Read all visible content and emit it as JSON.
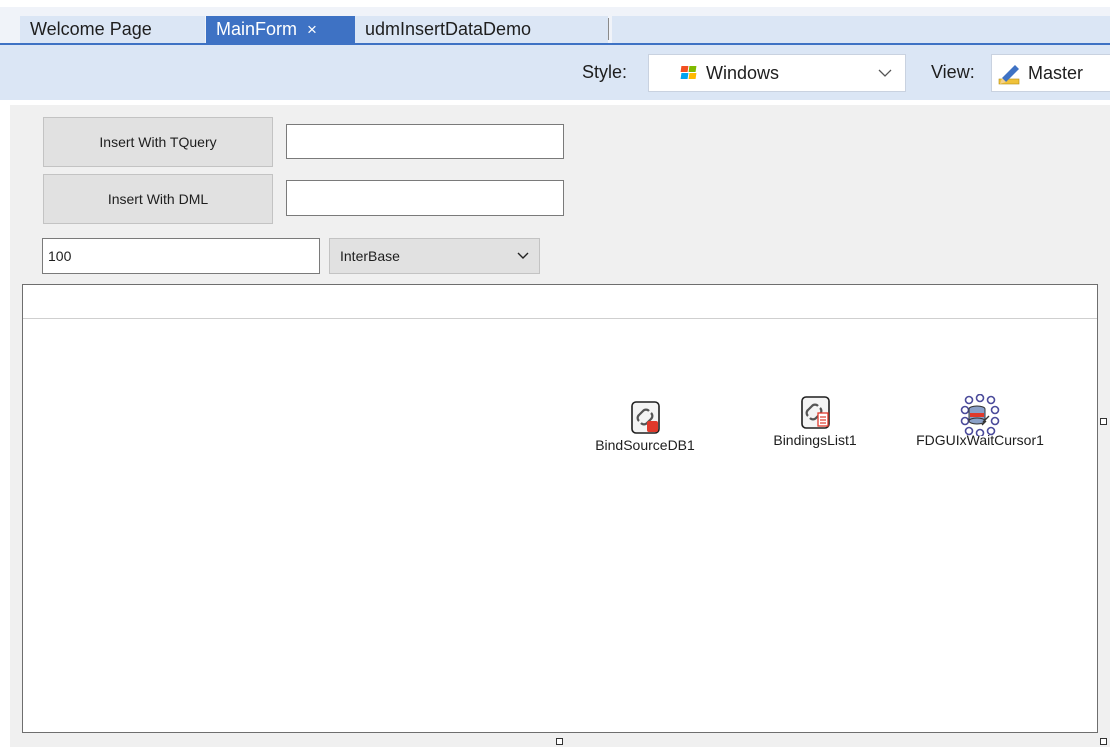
{
  "tabs": [
    {
      "label": "Welcome Page"
    },
    {
      "label": "MainForm",
      "close": "×"
    },
    {
      "label": "udmInsertDataDemo"
    }
  ],
  "toolbar": {
    "style_label": "Style:",
    "style_value": "Windows",
    "view_label": "View:",
    "view_value": "Master"
  },
  "form": {
    "insert_tquery_label": "Insert With TQuery",
    "insert_dml_label": "Insert With DML",
    "tquery_result": "",
    "dml_result": "",
    "record_count": "100",
    "database_selected": "InterBase"
  },
  "components": [
    {
      "label": "BindSourceDB1",
      "icon": "bind-source-icon"
    },
    {
      "label": "BindingsList1",
      "icon": "bindings-list-icon"
    },
    {
      "label": "FDGUIxWaitCursor1",
      "icon": "wait-cursor-icon"
    }
  ],
  "colors": {
    "accent": "#3e72c4",
    "toolbar_bg": "#dbe6f5",
    "form_bg": "#f0f0f0"
  }
}
